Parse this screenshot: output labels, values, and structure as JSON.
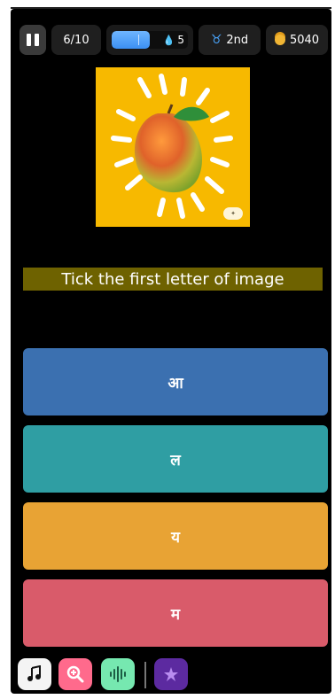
{
  "header": {
    "progress": "6/10",
    "timer_value": "5",
    "timer_fill_fraction": 0.5,
    "rank": "2nd",
    "coins": "5040"
  },
  "question": {
    "instruction": "Tick the first letter of image",
    "image_subject": "mango"
  },
  "options": [
    {
      "label": "आ",
      "color": "#3b70b0"
    },
    {
      "label": "ल",
      "color": "#2f9ea3"
    },
    {
      "label": "य",
      "color": "#e8a334"
    },
    {
      "label": "म",
      "color": "#d95b6a"
    }
  ],
  "toolbar": {
    "icons": [
      "music-note-icon",
      "zoom-icon",
      "audio-wave-icon",
      "power-up-icon"
    ]
  },
  "colors": {
    "background": "#000000",
    "image_background": "#f7b900",
    "instruction_background": "#6e6200"
  }
}
